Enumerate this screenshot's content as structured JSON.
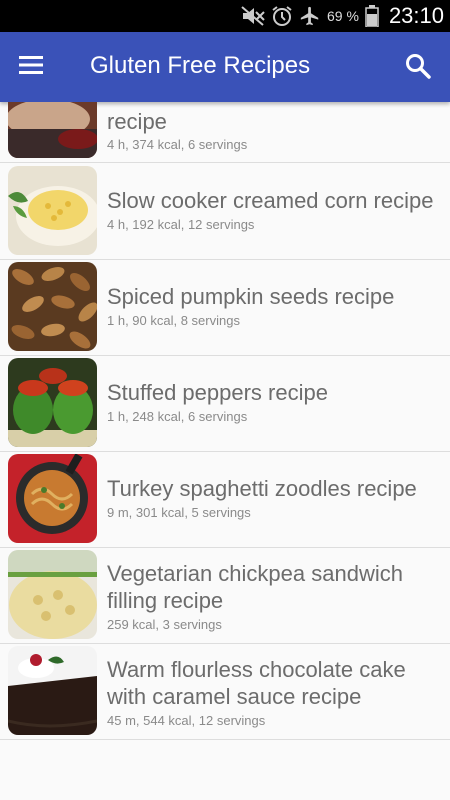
{
  "status_bar": {
    "battery_percent": "69 %",
    "time": "23:10"
  },
  "app_bar": {
    "title": "Gluten Free Recipes"
  },
  "recipes": [
    {
      "title": "recipe",
      "meta": "4 h, 374 kcal, 6 servings",
      "image": "roast-meat"
    },
    {
      "title": "Slow cooker creamed corn recipe",
      "meta": "4 h, 192 kcal, 12 servings",
      "image": "creamed-corn"
    },
    {
      "title": "Spiced pumpkin seeds recipe",
      "meta": "1 h, 90 kcal, 8 servings",
      "image": "pumpkin-seeds"
    },
    {
      "title": "Stuffed peppers recipe",
      "meta": "1 h, 248 kcal, 6 servings",
      "image": "stuffed-peppers"
    },
    {
      "title": "Turkey spaghetti zoodles recipe",
      "meta": "9 m, 301 kcal, 5 servings",
      "image": "spaghetti-zoodles"
    },
    {
      "title_line1": "Vegetarian chickpea sandwich",
      "title_line2": "filling recipe",
      "meta": "259 kcal, 3 servings",
      "image": "chickpea-filling"
    },
    {
      "title_line1": "Warm flourless chocolate cake",
      "title_line2": "with caramel sauce recipe",
      "meta": "45 m, 544 kcal, 12 servings",
      "image": "chocolate-cake"
    }
  ]
}
